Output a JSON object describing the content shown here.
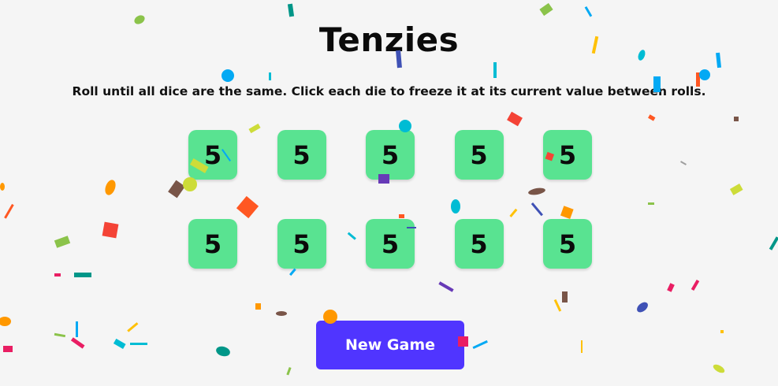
{
  "game": {
    "title": "Tenzies",
    "instructions": "Roll until all dice are the same. Click each die to freeze it at its current value between rolls.",
    "dice": [
      "5",
      "5",
      "5",
      "5",
      "5",
      "5",
      "5",
      "5",
      "5",
      "5"
    ],
    "new_game_label": "New Game"
  },
  "colors": {
    "background": "#f5f5f5",
    "die": "#59e391",
    "button": "#5035ff",
    "button_text": "#ffffff",
    "text": "#0b0b0b"
  }
}
